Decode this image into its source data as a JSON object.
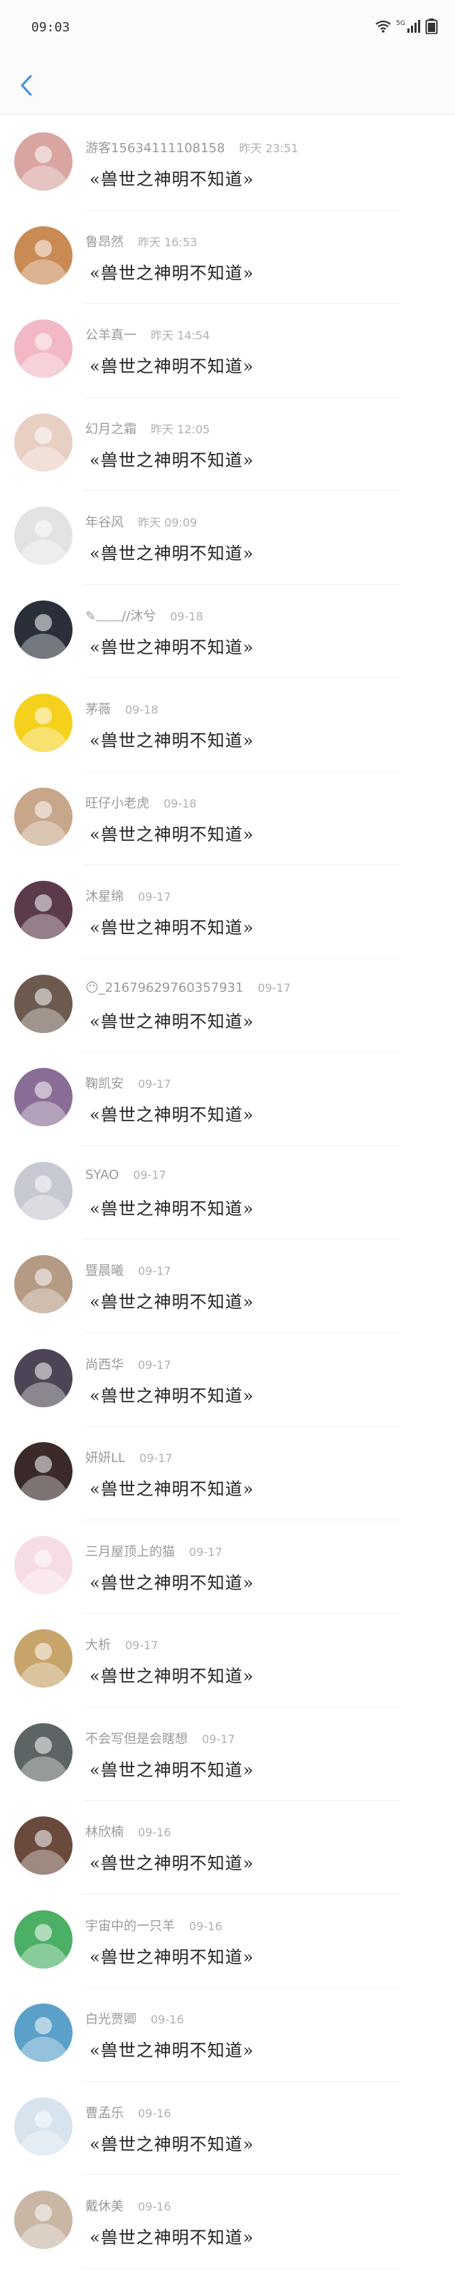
{
  "status_bar": {
    "time": "09:03",
    "network_label": "5G",
    "icons": [
      "wifi-icon",
      "signal-icon",
      "battery-icon"
    ]
  },
  "nav": {
    "back_icon": "chevron-left-icon",
    "accent": "#3d8fe0"
  },
  "rows": [
    {
      "name": "游客15634111108158",
      "time": "昨天 23:51",
      "message": "«兽世之神明不知道»",
      "avatar_color": "#d9a5a0"
    },
    {
      "name": "鲁昂然",
      "time": "昨天 16:53",
      "message": "«兽世之神明不知道»",
      "avatar_color": "#c98a54"
    },
    {
      "name": "公羊真一",
      "time": "昨天 14:54",
      "message": "«兽世之神明不知道»",
      "avatar_color": "#f2b8c6"
    },
    {
      "name": "幻月之霜",
      "time": "昨天 12:05",
      "message": "«兽世之神明不知道»",
      "avatar_color": "#e8cfc4"
    },
    {
      "name": "年谷风",
      "time": "昨天 09:09",
      "message": "«兽世之神明不知道»",
      "avatar_color": "#e3e3e3"
    },
    {
      "name": "✎﹏﹏//沐兮",
      "time": "09-18",
      "message": "«兽世之神明不知道»",
      "avatar_color": "#2a2f3a"
    },
    {
      "name": "茅薇",
      "time": "09-18",
      "message": "«兽世之神明不知道»",
      "avatar_color": "#f5d11d"
    },
    {
      "name": "旺仔小老虎",
      "time": "09-18",
      "message": "«兽世之神明不知道»",
      "avatar_color": "#c8a68a"
    },
    {
      "name": "沐星绵",
      "time": "09-17",
      "message": "«兽世之神明不知道»",
      "avatar_color": "#5b3a4c"
    },
    {
      "name": "😶_216796297603579​31",
      "time": "09-17",
      "message": "«兽世之神明不知道»",
      "avatar_color": "#6d5a4f"
    },
    {
      "name": "鞠凯安",
      "time": "09-17",
      "message": "«兽世之神明不知道»",
      "avatar_color": "#8a6d96"
    },
    {
      "name": "SYAO",
      "time": "09-17",
      "message": "«兽世之神明不知道»",
      "avatar_color": "#c6c9d2"
    },
    {
      "name": "暨晨曦",
      "time": "09-17",
      "message": "«兽世之神明不知道»",
      "avatar_color": "#b59a84"
    },
    {
      "name": "尚西华",
      "time": "09-17",
      "message": "«兽世之神明不知道»",
      "avatar_color": "#4d4555"
    },
    {
      "name": "妍妍LL",
      "time": "09-17",
      "message": "«兽世之神明不知道»",
      "avatar_color": "#3a2a2a"
    },
    {
      "name": "三月屋顶上的猫",
      "time": "09-17",
      "message": "«兽世之神明不知道»",
      "avatar_color": "#f6dde3"
    },
    {
      "name": "大析",
      "time": "09-17",
      "message": "«兽世之神明不知道»",
      "avatar_color": "#c7a56a"
    },
    {
      "name": "不会写但是会瞎想",
      "time": "09-17",
      "message": "«兽世之神明不知道»",
      "avatar_color": "#5d6466"
    },
    {
      "name": "林欣楠",
      "time": "09-16",
      "message": "«兽世之神明不知道»",
      "avatar_color": "#6b4a3e"
    },
    {
      "name": "宇宙中的一只羊",
      "time": "09-16",
      "message": "«兽世之神明不知道»",
      "avatar_color": "#4caf66"
    },
    {
      "name": "白光贾卿",
      "time": "09-16",
      "message": "«兽世之神明不知道»",
      "avatar_color": "#5aa0c8"
    },
    {
      "name": "曹孟乐",
      "time": "09-16",
      "message": "«兽世之神明不知道»",
      "avatar_color": "#d7e4ee"
    },
    {
      "name": "戴休美",
      "time": "09-16",
      "message": "«兽世之神明不知道»",
      "avatar_color": "#c9b6a4"
    }
  ]
}
